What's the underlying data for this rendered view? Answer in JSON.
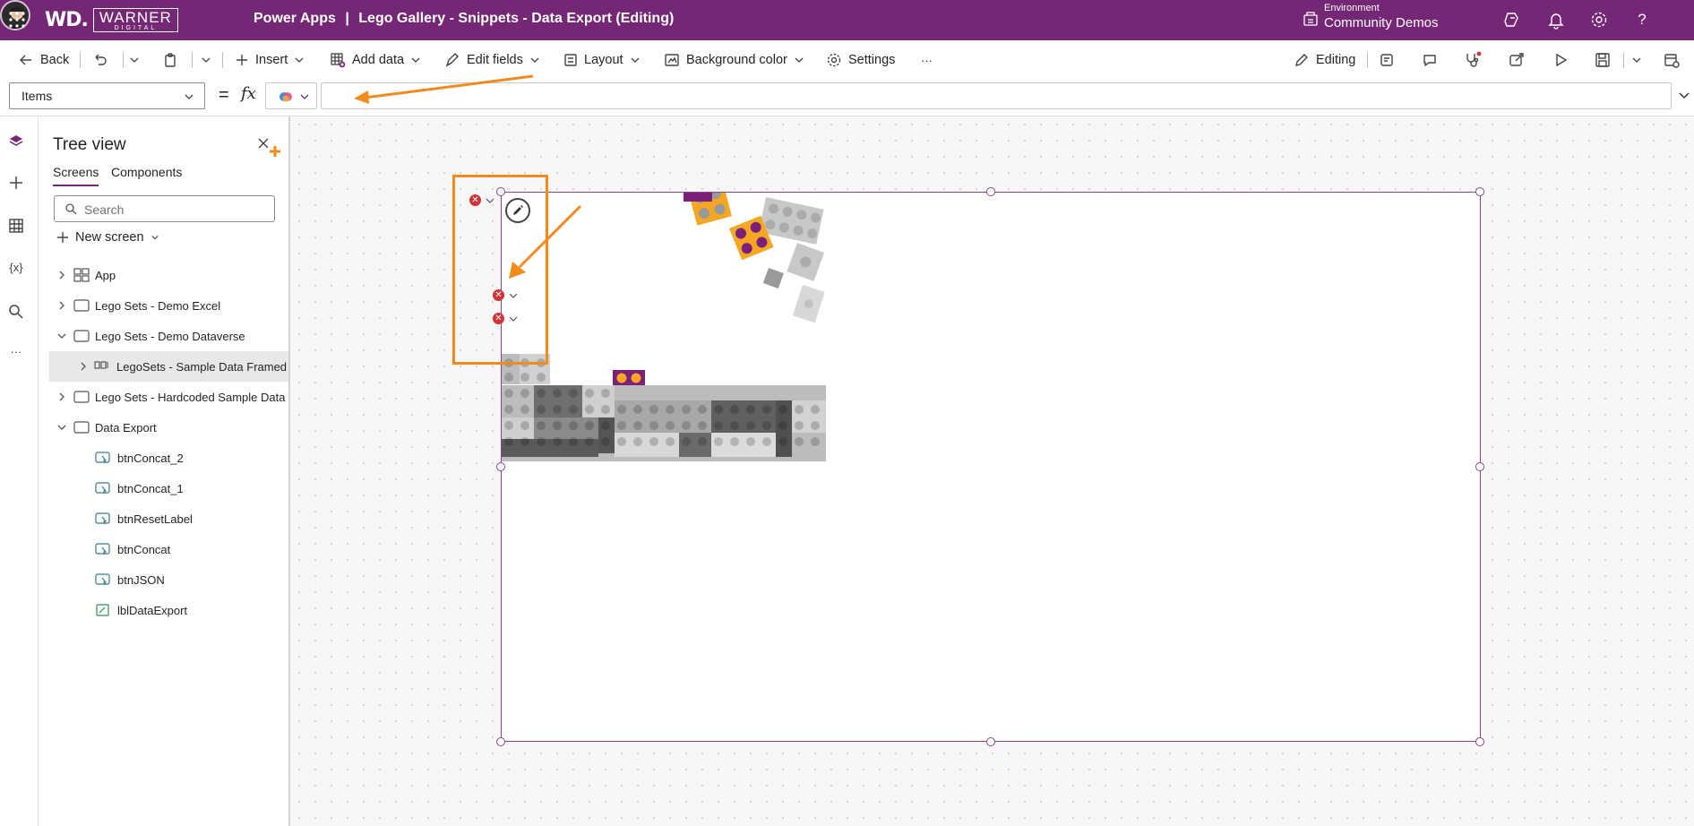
{
  "topbar": {
    "app_name": "Power Apps",
    "app_title": "Lego Gallery - Snippets - Data Export (Editing)",
    "logo_mono": "WD.",
    "logo_name": "WARNER",
    "logo_sub": "DIGITAL",
    "environment_label": "Environment",
    "environment_value": "Community Demos",
    "icons": [
      "waffle-icon",
      "environment-icon",
      "copilot-icon",
      "bell-icon",
      "gear-icon",
      "help-icon"
    ],
    "brand_color": "#742774"
  },
  "commandbar": {
    "back": "Back",
    "insert": "Insert",
    "add_data": "Add data",
    "edit_fields": "Edit fields",
    "layout": "Layout",
    "background_color": "Background color",
    "settings": "Settings",
    "more": "···",
    "editing": "Editing"
  },
  "formulabar": {
    "property": "Items",
    "equals": "=",
    "fx": "fx",
    "formula": ""
  },
  "tree": {
    "title": "Tree view",
    "tabs": [
      "Screens",
      "Components"
    ],
    "active_tab": "Screens",
    "search_placeholder": "Search",
    "new_screen": "New screen",
    "items": [
      {
        "label": "App",
        "level": 0,
        "expander": "collapsed",
        "icon": "app-icon"
      },
      {
        "label": "Lego Sets - Demo Excel",
        "level": 0,
        "expander": "collapsed",
        "icon": "screen-icon"
      },
      {
        "label": "Lego Sets - Demo Dataverse",
        "level": 0,
        "expander": "expanded",
        "icon": "screen-icon"
      },
      {
        "label": "LegoSets - Sample Data Framed SVG",
        "level": 1,
        "expander": "collapsed",
        "icon": "gallery-icon",
        "selected": true
      },
      {
        "label": "Lego Sets - Hardcoded Sample Data",
        "level": 0,
        "expander": "collapsed",
        "icon": "screen-icon"
      },
      {
        "label": "Data Export",
        "level": 0,
        "expander": "expanded",
        "icon": "screen-icon"
      },
      {
        "label": "btnConcat_2",
        "level": 1,
        "icon": "button-icon"
      },
      {
        "label": "btnConcat_1",
        "level": 1,
        "icon": "button-icon"
      },
      {
        "label": "btnResetLabel",
        "level": 1,
        "icon": "button-icon"
      },
      {
        "label": "btnConcat",
        "level": 1,
        "icon": "button-icon"
      },
      {
        "label": "btnJSON",
        "level": 1,
        "icon": "button-icon"
      },
      {
        "label": "lblDataExport",
        "level": 1,
        "icon": "label-icon"
      }
    ]
  },
  "canvas": {
    "highlight_color": "#f38a1d",
    "error_color": "#d13438",
    "selection_color": "#8a458a"
  }
}
